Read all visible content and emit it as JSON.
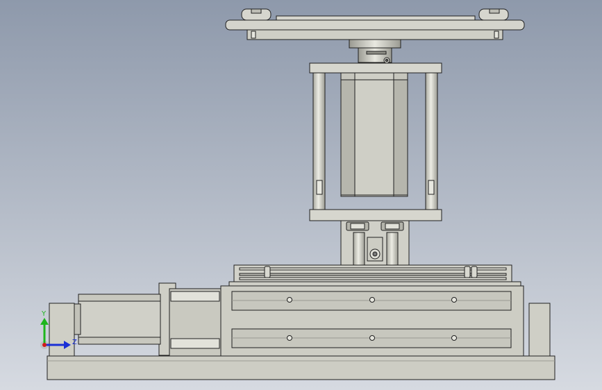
{
  "view": {
    "background_top": "#8e99ab",
    "background_bottom": "#d6dae1",
    "part_fill": "#cfcfc6",
    "part_fill_dark": "#b9b9b0",
    "part_fill_light": "#e2e2da",
    "edge_color": "#1f1f1f"
  },
  "triad": {
    "y_label": "Y",
    "z_label": "Z",
    "y_color": "#1db51d",
    "z_color": "#1a2fd6",
    "x_color": "#d21c1c"
  }
}
